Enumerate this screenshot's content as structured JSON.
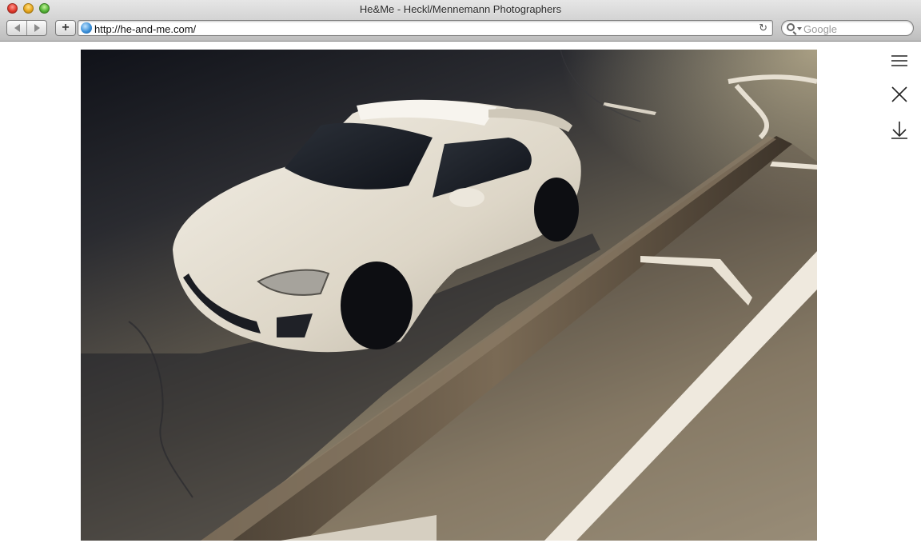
{
  "window": {
    "title": "He&Me - Heckl/Mennemann Photographers"
  },
  "toolbar": {
    "add_label": "+",
    "url": "http://he-and-me.com/",
    "reload_glyph": "↻",
    "search_placeholder": "Google"
  },
  "icons": {
    "back": "back-arrow-icon",
    "forward": "forward-arrow-icon",
    "menu": "hamburger-menu-icon",
    "close": "close-icon",
    "download": "download-arrow-icon"
  },
  "photo": {
    "alt": "white sports car parked at curb"
  }
}
